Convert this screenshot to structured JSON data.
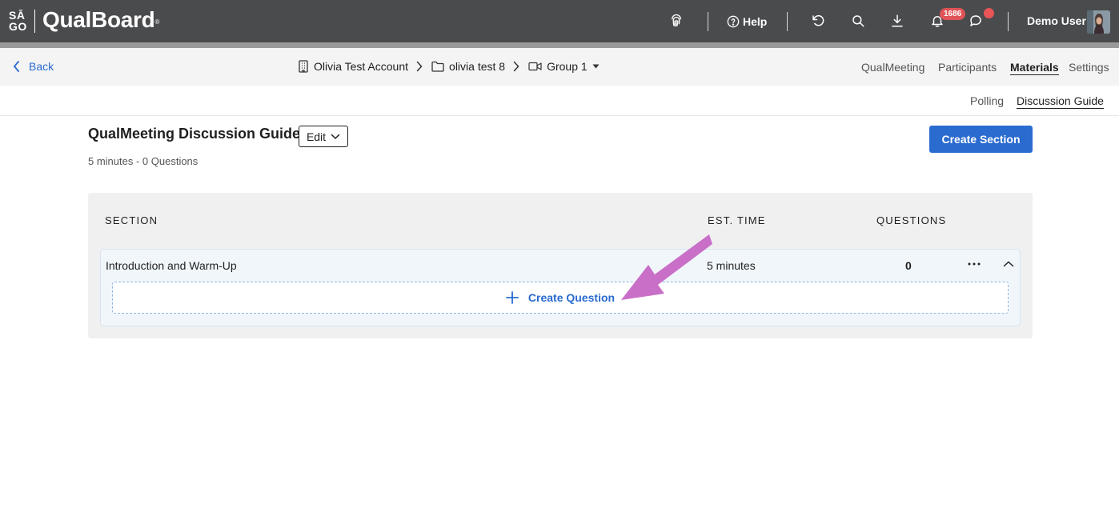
{
  "app": {
    "logo_mark_top": "SĀ",
    "logo_mark_bottom": "GO",
    "logo_text": "QualBoard",
    "logo_reg": "®"
  },
  "topbar": {
    "help_label": "Help",
    "notification_count": "1686",
    "user_name": "Demo User",
    "icons": [
      "fingerprint-icon",
      "help-circle-icon",
      "undo-icon",
      "search-icon",
      "download-icon",
      "bell-icon",
      "chat-icon"
    ]
  },
  "nav": {
    "back_label": "Back",
    "breadcrumbs": [
      {
        "label": "Olivia Test Account",
        "icon": "building-icon"
      },
      {
        "label": "olivia test 8",
        "icon": "folder-icon"
      },
      {
        "label": "Group 1",
        "icon": "video-icon"
      }
    ],
    "tabs": [
      {
        "label": "QualMeeting",
        "active": false
      },
      {
        "label": "Participants",
        "active": false
      },
      {
        "label": "Materials",
        "active": true
      },
      {
        "label": "Settings",
        "active": false
      }
    ]
  },
  "subnav": {
    "tabs": [
      {
        "label": "Polling",
        "active": false
      },
      {
        "label": "Discussion Guide",
        "active": true
      }
    ]
  },
  "page": {
    "title": "QualMeeting Discussion Guide",
    "edit_label": "Edit",
    "meta": "5 minutes - 0 Questions",
    "create_section_label": "Create Section"
  },
  "table": {
    "columns": {
      "section": "SECTION",
      "est_time": "EST. TIME",
      "questions": "QUESTIONS"
    },
    "rows": [
      {
        "title": "Introduction and Warm-Up",
        "est_time": "5 minutes",
        "questions": "0",
        "create_question_label": "Create Question"
      }
    ]
  },
  "colors": {
    "topbar": "#4a4b4d",
    "accent": "#2a6bd0",
    "annotation_arrow": "#c96fc8",
    "badge": "#e05356"
  }
}
